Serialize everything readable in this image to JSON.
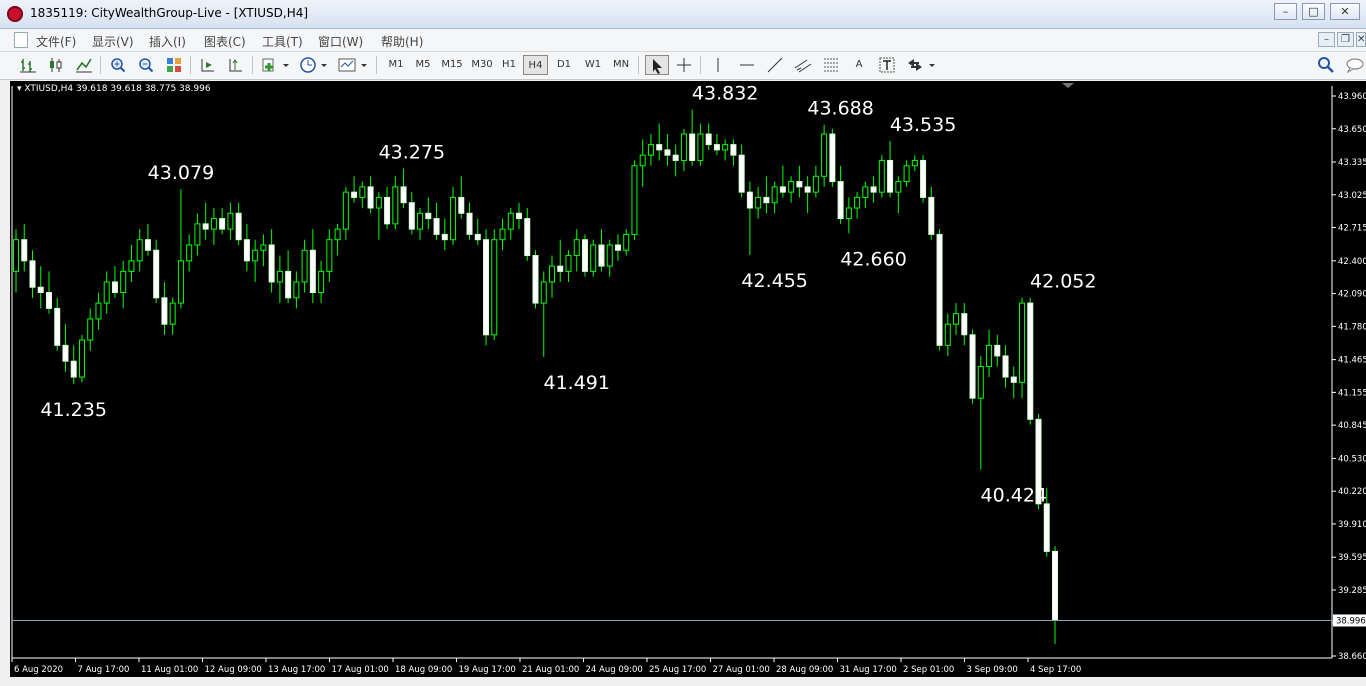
{
  "window": {
    "title": "1835119: CityWealthGroup-Live - [XTIUSD,H4]",
    "controls": [
      "–",
      "□",
      "✕"
    ]
  },
  "menu": {
    "items": [
      "文件(F)",
      "显示(V)",
      "插入(I)",
      "图表(C)",
      "工具(T)",
      "窗口(W)",
      "帮助(H)"
    ],
    "mdi_controls": [
      "–",
      "❐",
      "✕"
    ]
  },
  "toolbar": {
    "timeframes": [
      "M1",
      "M5",
      "M15",
      "M30",
      "H1",
      "H4",
      "D1",
      "W1",
      "MN"
    ],
    "selected_timeframe": "H4",
    "tools": [
      "bar-chart-icon",
      "candlestick-icon",
      "line-chart-icon",
      "zoom-in-icon",
      "zoom-out-icon",
      "tile-windows-icon",
      "autoscroll-icon",
      "chart-shift-icon",
      "indicators-icon",
      "periodicity-icon",
      "templates-icon",
      "cursor-icon",
      "crosshair-icon",
      "vertical-line-icon",
      "horizontal-line-icon",
      "trendline-icon",
      "equidistant-channel-icon",
      "fibonacci-icon",
      "text-icon",
      "text-label-icon",
      "arrows-icon"
    ],
    "text_tool": "A",
    "colors": {
      "accent": "#2a7a2a",
      "bg": "#f5f6f8"
    }
  },
  "chart_data": {
    "type": "candlestick",
    "header": "XTIUSD,H4  39.618 39.618 38.775 38.996",
    "ylim": [
      38.66,
      43.96
    ],
    "y_ticks": [
      43.96,
      43.65,
      43.335,
      43.025,
      42.715,
      42.4,
      42.09,
      41.78,
      41.465,
      41.155,
      40.845,
      40.53,
      40.22,
      39.91,
      39.595,
      39.285,
      38.975,
      38.66
    ],
    "y_tick_labels": [
      "43.960",
      "43.650",
      "43.335",
      "43.025",
      "42.715",
      "42.400",
      "42.090",
      "41.780",
      "41.465",
      "41.155",
      "40.845",
      "40.530",
      "40.220",
      "39.910",
      "39.595",
      "39.285",
      "38.975",
      "38.660"
    ],
    "x_tick_labels": [
      "6 Aug 2020",
      "7 Aug 17:00",
      "11 Aug 01:00",
      "12 Aug 09:00",
      "13 Aug 17:00",
      "17 Aug 01:00",
      "18 Aug 09:00",
      "19 Aug 17:00",
      "21 Aug 01:00",
      "24 Aug 09:00",
      "25 Aug 17:00",
      "27 Aug 01:00",
      "28 Aug 09:00",
      "31 Aug 17:00",
      "2 Sep 01:00",
      "3 Sep 09:00",
      "4 Sep 17:00"
    ],
    "current_price": 38.996,
    "current_price_label": "38.996",
    "annotations": [
      {
        "text": "41.235",
        "x": 7,
        "y": 41.235,
        "pos": "below"
      },
      {
        "text": "43.079",
        "x": 20,
        "y": 43.079,
        "pos": "above"
      },
      {
        "text": "43.275",
        "x": 48,
        "y": 43.275,
        "pos": "above"
      },
      {
        "text": "41.491",
        "x": 68,
        "y": 41.491,
        "pos": "below"
      },
      {
        "text": "43.832",
        "x": 86,
        "y": 43.832,
        "pos": "above"
      },
      {
        "text": "42.455",
        "x": 92,
        "y": 42.455,
        "pos": "below"
      },
      {
        "text": "43.688",
        "x": 100,
        "y": 43.688,
        "pos": "above"
      },
      {
        "text": "42.660",
        "x": 104,
        "y": 42.66,
        "pos": "below"
      },
      {
        "text": "43.535",
        "x": 110,
        "y": 43.535,
        "pos": "above"
      },
      {
        "text": "40.424",
        "x": 121,
        "y": 40.424,
        "pos": "below"
      },
      {
        "text": "42.052",
        "x": 127,
        "y": 42.052,
        "pos": "above"
      }
    ],
    "candles": [
      [
        42.3,
        42.7,
        42.1,
        42.6
      ],
      [
        42.6,
        42.75,
        42.3,
        42.4
      ],
      [
        42.4,
        42.5,
        42.05,
        42.15
      ],
      [
        42.15,
        42.35,
        41.95,
        42.1
      ],
      [
        42.1,
        42.3,
        41.9,
        41.95
      ],
      [
        41.95,
        42.05,
        41.55,
        41.6
      ],
      [
        41.6,
        41.8,
        41.35,
        41.45
      ],
      [
        41.45,
        41.6,
        41.235,
        41.3
      ],
      [
        41.3,
        41.7,
        41.25,
        41.65
      ],
      [
        41.65,
        41.95,
        41.55,
        41.85
      ],
      [
        41.85,
        42.1,
        41.75,
        42.0
      ],
      [
        42.0,
        42.3,
        41.9,
        42.2
      ],
      [
        42.2,
        42.35,
        42.05,
        42.1
      ],
      [
        42.1,
        42.4,
        41.95,
        42.3
      ],
      [
        42.3,
        42.55,
        42.2,
        42.4
      ],
      [
        42.4,
        42.7,
        42.3,
        42.6
      ],
      [
        42.6,
        42.75,
        42.45,
        42.5
      ],
      [
        42.5,
        42.6,
        42.0,
        42.05
      ],
      [
        42.05,
        42.2,
        41.7,
        41.8
      ],
      [
        41.8,
        42.05,
        41.7,
        42.0
      ],
      [
        42.0,
        43.079,
        41.95,
        42.4
      ],
      [
        42.4,
        42.65,
        42.3,
        42.55
      ],
      [
        42.55,
        42.85,
        42.45,
        42.75
      ],
      [
        42.75,
        42.95,
        42.6,
        42.7
      ],
      [
        42.7,
        42.9,
        42.55,
        42.8
      ],
      [
        42.8,
        42.9,
        42.65,
        42.7
      ],
      [
        42.7,
        42.95,
        42.6,
        42.85
      ],
      [
        42.85,
        42.95,
        42.55,
        42.6
      ],
      [
        42.6,
        42.75,
        42.3,
        42.4
      ],
      [
        42.4,
        42.6,
        42.2,
        42.5
      ],
      [
        42.5,
        42.65,
        42.35,
        42.55
      ],
      [
        42.55,
        42.7,
        42.1,
        42.2
      ],
      [
        42.2,
        42.45,
        42.0,
        42.3
      ],
      [
        42.3,
        42.5,
        42.0,
        42.05
      ],
      [
        42.05,
        42.3,
        41.95,
        42.2
      ],
      [
        42.2,
        42.6,
        42.1,
        42.5
      ],
      [
        42.5,
        42.7,
        42.0,
        42.1
      ],
      [
        42.1,
        42.4,
        42.0,
        42.3
      ],
      [
        42.3,
        42.7,
        42.2,
        42.6
      ],
      [
        42.6,
        42.75,
        42.45,
        42.7
      ],
      [
        42.7,
        43.1,
        42.6,
        43.05
      ],
      [
        43.05,
        43.2,
        42.95,
        43.0
      ],
      [
        43.0,
        43.15,
        42.9,
        43.1
      ],
      [
        43.1,
        43.2,
        42.85,
        42.9
      ],
      [
        42.9,
        43.05,
        42.6,
        43.0
      ],
      [
        43.0,
        43.1,
        42.7,
        42.75
      ],
      [
        42.75,
        43.2,
        42.7,
        43.1
      ],
      [
        43.1,
        43.275,
        42.9,
        42.95
      ],
      [
        42.95,
        43.05,
        42.65,
        42.7
      ],
      [
        42.7,
        42.9,
        42.6,
        42.85
      ],
      [
        42.85,
        43.0,
        42.7,
        42.8
      ],
      [
        42.8,
        42.95,
        42.6,
        42.65
      ],
      [
        42.65,
        42.8,
        42.5,
        42.6
      ],
      [
        42.6,
        43.1,
        42.55,
        43.0
      ],
      [
        43.0,
        43.2,
        42.8,
        42.85
      ],
      [
        42.85,
        42.95,
        42.6,
        42.65
      ],
      [
        42.65,
        42.8,
        42.55,
        42.6
      ],
      [
        42.6,
        42.7,
        41.6,
        41.7
      ],
      [
        41.7,
        42.7,
        41.65,
        42.6
      ],
      [
        42.6,
        42.8,
        42.5,
        42.7
      ],
      [
        42.7,
        42.9,
        42.6,
        42.85
      ],
      [
        42.85,
        42.95,
        42.7,
        42.8
      ],
      [
        42.8,
        42.9,
        42.4,
        42.45
      ],
      [
        42.45,
        42.5,
        41.95,
        42.0
      ],
      [
        42.0,
        42.3,
        41.491,
        42.2
      ],
      [
        42.2,
        42.45,
        42.05,
        42.35
      ],
      [
        42.35,
        42.6,
        42.2,
        42.3
      ],
      [
        42.3,
        42.5,
        42.2,
        42.45
      ],
      [
        42.45,
        42.7,
        42.3,
        42.6
      ],
      [
        42.6,
        42.65,
        42.25,
        42.3
      ],
      [
        42.3,
        42.6,
        42.25,
        42.55
      ],
      [
        42.55,
        42.7,
        42.3,
        42.35
      ],
      [
        42.35,
        42.6,
        42.25,
        42.55
      ],
      [
        42.55,
        42.65,
        42.4,
        42.5
      ],
      [
        42.5,
        42.7,
        42.45,
        42.65
      ],
      [
        42.65,
        43.35,
        42.6,
        43.3
      ],
      [
        43.3,
        43.55,
        43.1,
        43.4
      ],
      [
        43.4,
        43.6,
        43.3,
        43.5
      ],
      [
        43.5,
        43.7,
        43.35,
        43.45
      ],
      [
        43.45,
        43.6,
        43.3,
        43.4
      ],
      [
        43.4,
        43.5,
        43.2,
        43.35
      ],
      [
        43.35,
        43.65,
        43.25,
        43.6
      ],
      [
        43.6,
        43.832,
        43.3,
        43.35
      ],
      [
        43.35,
        43.7,
        43.3,
        43.6
      ],
      [
        43.6,
        43.7,
        43.45,
        43.5
      ],
      [
        43.5,
        43.6,
        43.4,
        43.45
      ],
      [
        43.45,
        43.55,
        43.35,
        43.5
      ],
      [
        43.5,
        43.55,
        43.3,
        43.4
      ],
      [
        43.4,
        43.5,
        43.0,
        43.05
      ],
      [
        43.05,
        43.15,
        42.455,
        42.9
      ],
      [
        42.9,
        43.1,
        42.8,
        43.0
      ],
      [
        43.0,
        43.2,
        42.85,
        42.95
      ],
      [
        42.95,
        43.15,
        42.85,
        43.1
      ],
      [
        43.1,
        43.3,
        43.0,
        43.05
      ],
      [
        43.05,
        43.2,
        42.95,
        43.15
      ],
      [
        43.15,
        43.3,
        43.0,
        43.1
      ],
      [
        43.1,
        43.2,
        42.85,
        43.05
      ],
      [
        43.05,
        43.3,
        43.0,
        43.2
      ],
      [
        43.2,
        43.688,
        43.1,
        43.6
      ],
      [
        43.6,
        43.65,
        43.1,
        43.15
      ],
      [
        43.15,
        43.3,
        42.75,
        42.8
      ],
      [
        42.8,
        43.0,
        42.66,
        42.9
      ],
      [
        42.9,
        43.05,
        42.8,
        43.0
      ],
      [
        43.0,
        43.15,
        42.9,
        43.1
      ],
      [
        43.1,
        43.2,
        42.95,
        43.05
      ],
      [
        43.05,
        43.4,
        43.0,
        43.35
      ],
      [
        43.35,
        43.535,
        43.0,
        43.05
      ],
      [
        43.05,
        43.2,
        42.85,
        43.15
      ],
      [
        43.15,
        43.35,
        43.1,
        43.3
      ],
      [
        43.3,
        43.4,
        43.25,
        43.35
      ],
      [
        43.35,
        43.4,
        42.95,
        43.0
      ],
      [
        43.0,
        43.1,
        42.6,
        42.65
      ],
      [
        42.65,
        42.7,
        41.55,
        41.6
      ],
      [
        41.6,
        41.9,
        41.5,
        41.8
      ],
      [
        41.8,
        42.0,
        41.7,
        41.9
      ],
      [
        41.9,
        42.0,
        41.6,
        41.7
      ],
      [
        41.7,
        41.75,
        41.05,
        41.1
      ],
      [
        41.1,
        41.5,
        40.424,
        41.4
      ],
      [
        41.4,
        41.75,
        41.3,
        41.6
      ],
      [
        41.6,
        41.7,
        41.4,
        41.5
      ],
      [
        41.5,
        41.6,
        41.2,
        41.3
      ],
      [
        41.3,
        41.4,
        41.1,
        41.25
      ],
      [
        41.25,
        42.052,
        41.1,
        42.0
      ],
      [
        42.0,
        42.05,
        40.85,
        40.9
      ],
      [
        40.9,
        40.95,
        40.05,
        40.1
      ],
      [
        40.1,
        40.25,
        39.6,
        39.65
      ],
      [
        39.65,
        39.7,
        38.775,
        38.996
      ]
    ]
  }
}
